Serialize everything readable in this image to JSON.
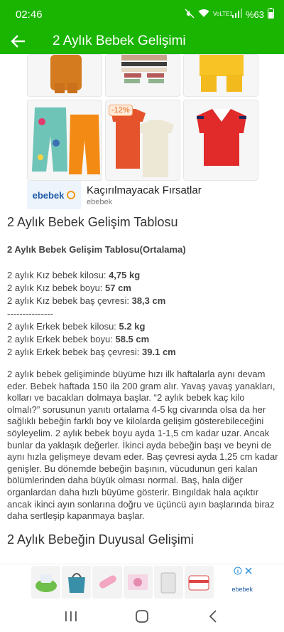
{
  "statusbar": {
    "time": "02:46",
    "battery": "%63",
    "network": "VoLTE1"
  },
  "appbar": {
    "title": "2 Aylık Bebek Gelişimi"
  },
  "ad": {
    "discount_badge": "-12%",
    "brand": "ebebek",
    "headline": "Kaçırılmayacak Fırsatlar",
    "source": "ebebek"
  },
  "article": {
    "heading": "2 Aylık Bebek Gelişim Tablosu",
    "subheading": "2 Aylık Bebek Gelişim Tablosu(Ortalama)",
    "girl": {
      "weight_label": "2 aylık Kız bebek kilosu: ",
      "weight_value": "4,75 kg",
      "height_label": "2 aylık Kız bebek boyu: ",
      "height_value": "57 cm",
      "head_label": "2 aylık Kız bebek baş çevresi: ",
      "head_value": "38,3 cm"
    },
    "separator": "---------------",
    "boy": {
      "weight_label": "2 aylık Erkek bebek kilosu: ",
      "weight_value": "5.2 kg",
      "height_label": "2 aylık Erkek bebek boyu: ",
      "height_value": "58.5 cm",
      "head_label": "2 aylık Erkek bebek baş çevresi: ",
      "head_value": "39.1 cm"
    },
    "paragraph": "2 aylık bebek gelişiminde büyüme hızı ilk haftalarla aynı devam eder. Bebek haftada 150 ila 200 gram alır. Yavaş yavaş yanakları, kolları ve bacakları dolmaya başlar. “2 aylık bebek kaç kilo olmalı?” sorusunun yanıtı ortalama 4-5 kg civarında olsa da her sağlıklı bebeğin farklı boy ve kilolarda gelişim gösterebileceğini söyleyelim. 2 aylık bebek boyu ayda 1-1,5 cm kadar uzar. Ancak bunlar da yaklaşık değerler. İkinci ayda bebeğin başı ve beyni de aynı hızla gelişmeye devam eder. Baş çevresi ayda 1,25 cm kadar genişler. Bu dönemde bebeğin başının, vücudunun geri kalan bölümlerinden daha büyük olması normal. Baş, hala diğer organlardan daha hızlı büyüme gösterir. Bıngıldak hala açıktır ancak ikinci ayın sonlarına doğru ve üçüncü ayın başlarında biraz daha sertleşip kapanmaya başlar.",
    "section2_heading": "2 Aylık Bebeğin Duyusal Gelişimi"
  },
  "banner": {
    "brand": "ebebek"
  },
  "colors": {
    "appbar": "#19b500",
    "text": "#444444"
  },
  "icons": [
    "back-arrow-icon",
    "mute-icon",
    "wifi-icon",
    "signal-icon",
    "battery-icon",
    "recents-icon",
    "home-icon",
    "back-icon",
    "info-icon",
    "close-icon"
  ]
}
